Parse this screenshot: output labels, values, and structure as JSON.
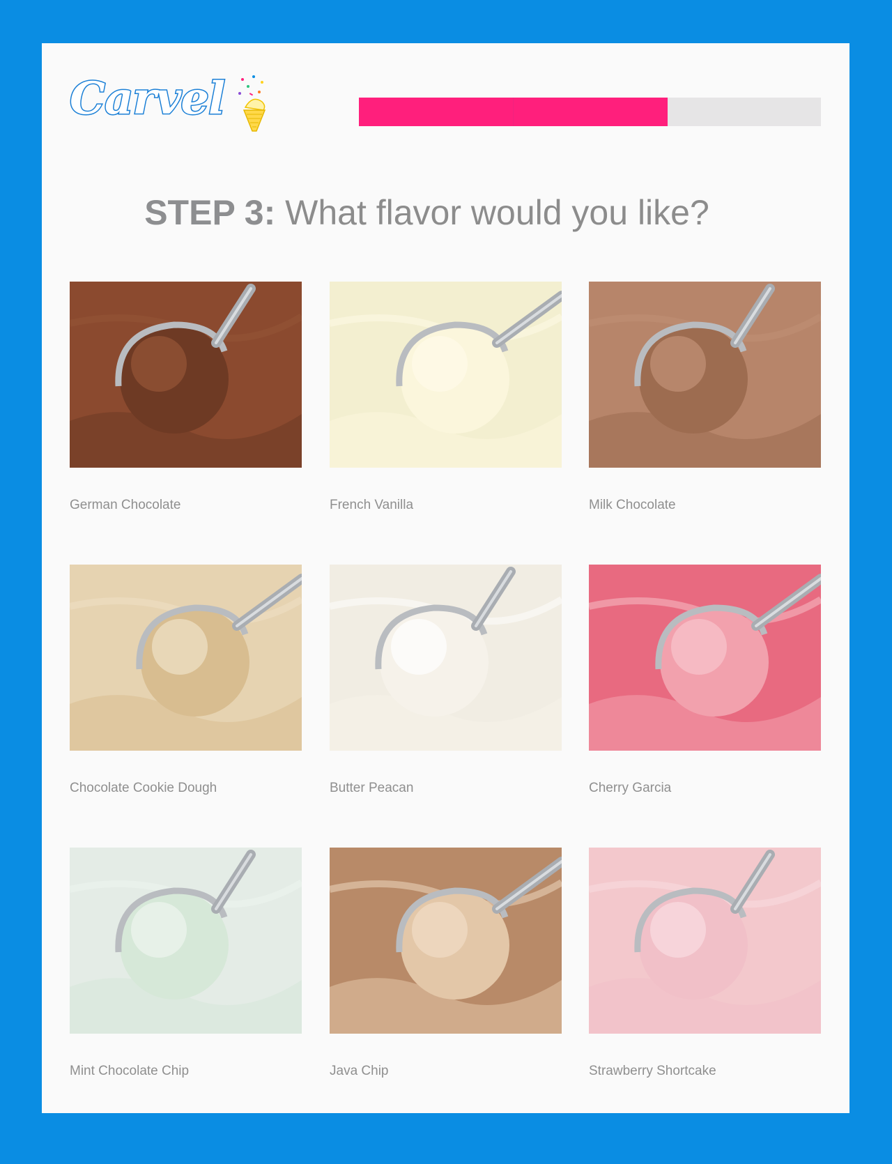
{
  "brand": {
    "logo_text": "Carvel"
  },
  "progress": {
    "steps_total": 3,
    "steps_completed": 2,
    "fill_color": "#ff1f7c",
    "track_color": "#e6e5e6"
  },
  "heading": {
    "step": "STEP 3:",
    "question": "What flavor would you like?"
  },
  "colors": {
    "frame": "#0a8de3",
    "card": "#fafafa",
    "text": "#8f8f8f"
  },
  "flavors": [
    {
      "label": "German Chocolate",
      "icon": "ice-cream-scoop-photo",
      "base": "#8b4a2f",
      "scoop": "#6e3a24",
      "scoop_light": "#955537"
    },
    {
      "label": "French Vanilla",
      "icon": "ice-cream-scoop-photo",
      "base": "#f3efd0",
      "scoop": "#fbf6dc",
      "scoop_light": "#fffbe8"
    },
    {
      "label": "Milk Chocolate",
      "icon": "ice-cream-scoop-photo",
      "base": "#b7856a",
      "scoop": "#9d6c50",
      "scoop_light": "#c29276"
    },
    {
      "label": "Chocolate Cookie Dough",
      "icon": "ice-cream-scoop-photo",
      "base": "#e6d3b1",
      "scoop": "#d8bd90",
      "scoop_light": "#f0e2c8"
    },
    {
      "label": "Butter Peacan",
      "icon": "ice-cream-scoop-photo",
      "base": "#f1ede3",
      "scoop": "#f6f2ea",
      "scoop_light": "#ffffff"
    },
    {
      "label": "Cherry Garcia",
      "icon": "ice-cream-scoop-photo",
      "base": "#e86a80",
      "scoop": "#f2a1ad",
      "scoop_light": "#f8c5cc"
    },
    {
      "label": "Mint Chocolate Chip",
      "icon": "ice-cream-scoop-photo",
      "base": "#e4ece6",
      "scoop": "#d6e8d8",
      "scoop_light": "#eef5ef"
    },
    {
      "label": "Java Chip",
      "icon": "ice-cream-scoop-photo",
      "base": "#b88a68",
      "scoop": "#e3c7a8",
      "scoop_light": "#f1ddc6"
    },
    {
      "label": "Strawberry Shortcake",
      "icon": "ice-cream-scoop-photo",
      "base": "#f3c8cc",
      "scoop": "#f1c0c8",
      "scoop_light": "#f9dde1"
    }
  ]
}
